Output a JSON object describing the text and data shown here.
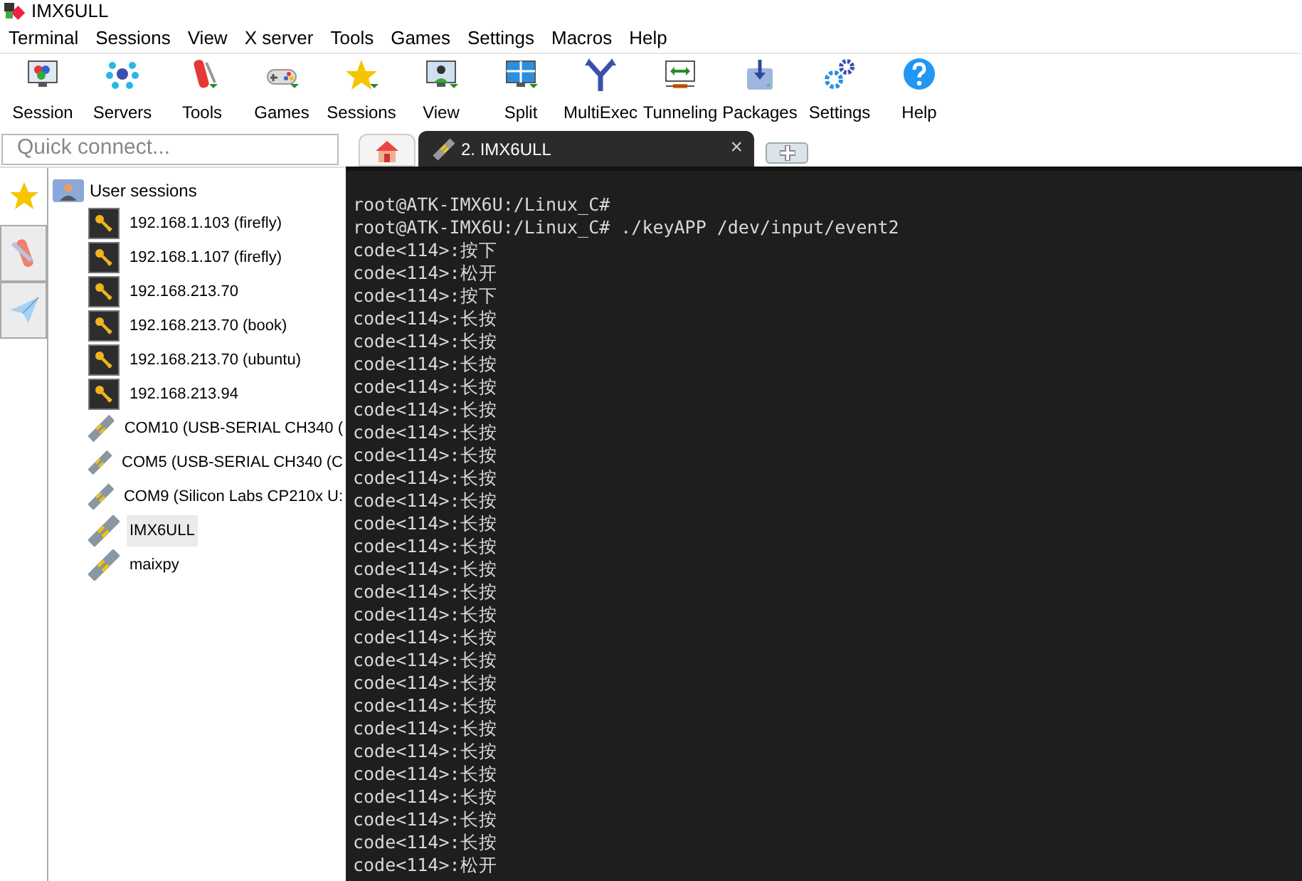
{
  "window": {
    "title": "IMX6ULL"
  },
  "menu": [
    "Terminal",
    "Sessions",
    "View",
    "X server",
    "Tools",
    "Games",
    "Settings",
    "Macros",
    "Help"
  ],
  "toolbar": [
    {
      "label": "Session",
      "kind": "session"
    },
    {
      "label": "Servers",
      "kind": "servers"
    },
    {
      "label": "Tools",
      "kind": "tools"
    },
    {
      "label": "Games",
      "kind": "games"
    },
    {
      "label": "Sessions",
      "kind": "star"
    },
    {
      "label": "View",
      "kind": "view"
    },
    {
      "label": "Split",
      "kind": "split"
    },
    {
      "label": "MultiExec",
      "kind": "multiexec"
    },
    {
      "label": "Tunneling",
      "kind": "tunneling"
    },
    {
      "label": "Packages",
      "kind": "packages"
    },
    {
      "label": "Settings",
      "kind": "settings"
    },
    {
      "label": "Help",
      "kind": "help"
    }
  ],
  "quick_connect": {
    "placeholder": "Quick connect..."
  },
  "tabs": [
    {
      "kind": "home",
      "selected": false
    },
    {
      "kind": "session",
      "label": "2. IMX6ULL",
      "selected": true,
      "close": "×"
    },
    {
      "kind": "new",
      "selected": false
    }
  ],
  "sidebar": {
    "tabs": [
      {
        "kind": "star",
        "selected": true
      },
      {
        "kind": "tools",
        "selected": false
      },
      {
        "kind": "send",
        "selected": false
      }
    ],
    "tree": {
      "label": "User sessions",
      "children": [
        {
          "label": "192.168.1.103 (firefly)",
          "kind": "ssh",
          "selected": false
        },
        {
          "label": "192.168.1.107 (firefly)",
          "kind": "ssh",
          "selected": false
        },
        {
          "label": "192.168.213.70",
          "kind": "ssh",
          "selected": false
        },
        {
          "label": "192.168.213.70 (book)",
          "kind": "ssh",
          "selected": false
        },
        {
          "label": "192.168.213.70 (ubuntu)",
          "kind": "ssh",
          "selected": false
        },
        {
          "label": "192.168.213.94",
          "kind": "ssh",
          "selected": false
        },
        {
          "label": "COM10  (USB-SERIAL CH340 (",
          "kind": "serial",
          "selected": false
        },
        {
          "label": "COM5  (USB-SERIAL CH340 (C",
          "kind": "serial",
          "selected": false
        },
        {
          "label": "COM9  (Silicon Labs CP210x U:",
          "kind": "serial",
          "selected": false
        },
        {
          "label": "IMX6ULL",
          "kind": "serial",
          "selected": true
        },
        {
          "label": "maixpy",
          "kind": "serial",
          "selected": false
        }
      ]
    }
  },
  "terminal": {
    "lines": [
      "root@ATK-IMX6U:/Linux_C#",
      "root@ATK-IMX6U:/Linux_C# ./keyAPP /dev/input/event2",
      "code<114>:按下",
      "code<114>:松开",
      "code<114>:按下",
      "code<114>:长按",
      "code<114>:长按",
      "code<114>:长按",
      "code<114>:长按",
      "code<114>:长按",
      "code<114>:长按",
      "code<114>:长按",
      "code<114>:长按",
      "code<114>:长按",
      "code<114>:长按",
      "code<114>:长按",
      "code<114>:长按",
      "code<114>:长按",
      "code<114>:长按",
      "code<114>:长按",
      "code<114>:长按",
      "code<114>:长按",
      "code<114>:长按",
      "code<114>:长按",
      "code<114>:长按",
      "code<114>:长按",
      "code<114>:长按",
      "code<114>:长按",
      "code<114>:长按",
      "code<114>:松开"
    ]
  }
}
